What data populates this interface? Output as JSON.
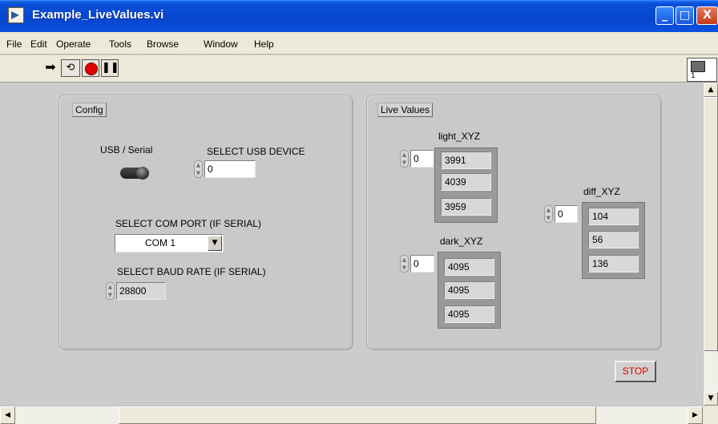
{
  "window": {
    "title": "Example_LiveValues.vi",
    "controls": {
      "minimize": "_",
      "maximize": "□",
      "close": "X"
    }
  },
  "menu": [
    "File",
    "Edit",
    "Operate",
    "Tools",
    "Browse",
    "Window",
    "Help"
  ],
  "toolbar": {
    "tools": [
      {
        "name": "run",
        "icon": "run-arrow-icon"
      },
      {
        "name": "run-continuously",
        "icon": "run-continuously-icon"
      },
      {
        "name": "abort",
        "icon": "abort-stop-icon"
      },
      {
        "name": "pause",
        "icon": "pause-icon"
      }
    ],
    "vi_icon_number": "1"
  },
  "config": {
    "group_label": "Config",
    "toggle_label": "USB / Serial",
    "usb_device_label": "SELECT USB DEVICE",
    "usb_device_value": "0",
    "com_port_label": "SELECT COM PORT (IF SERIAL)",
    "com_port_value": "COM 1",
    "baud_rate_label": "SELECT BAUD RATE (IF SERIAL)",
    "baud_rate_value": "28800"
  },
  "live": {
    "group_label": "Live Values",
    "light_xyz": {
      "label": "light_XYZ",
      "index": "0",
      "values": [
        "3991",
        "4039",
        "3959"
      ]
    },
    "dark_xyz": {
      "label": "dark_XYZ",
      "index": "0",
      "values": [
        "4095",
        "4095",
        "4095"
      ]
    },
    "diff_xyz": {
      "label": "diff_XYZ",
      "index": "0",
      "values": [
        "104",
        "56",
        "136"
      ]
    }
  },
  "stop_label": "STOP",
  "colors": {
    "titlebar": "#0a4fd8",
    "panel": "#cccccc",
    "stop_text": "#e00000",
    "abort": "#e30000"
  }
}
